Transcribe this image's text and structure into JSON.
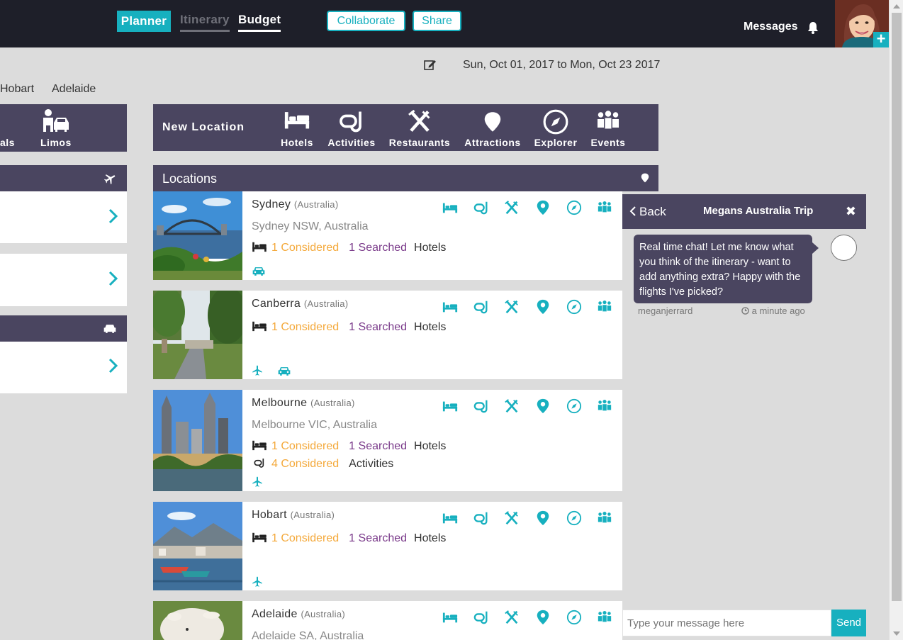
{
  "nav": {
    "tabs": [
      "Planner",
      "Itinerary",
      "Budget"
    ],
    "collaborate": "Collaborate",
    "share": "Share",
    "messages": "Messages",
    "avatar_plus": "+"
  },
  "trip": {
    "date_range": "Sun, Oct 01, 2017 to Mon, Oct 23 2017"
  },
  "left": {
    "city_tabs": [
      "Hobart",
      "Adelaide"
    ],
    "categories": [
      "als",
      "Limos"
    ]
  },
  "new_location": {
    "title": "New Location",
    "categories": [
      "Hotels",
      "Activities",
      "Restaurants",
      "Attractions",
      "Explorer",
      "Events"
    ]
  },
  "locations": {
    "title": "Locations",
    "items": [
      {
        "city": "Sydney",
        "country": "(Australia)",
        "address": "Sydney NSW, Australia",
        "stats": [
          {
            "considered": "1 Considered",
            "searched": "1 Searched",
            "type": "Hotels"
          }
        ]
      },
      {
        "city": "Canberra",
        "country": "(Australia)",
        "address": "",
        "stats": [
          {
            "considered": "1 Considered",
            "searched": "1 Searched",
            "type": "Hotels"
          }
        ]
      },
      {
        "city": "Melbourne",
        "country": "(Australia)",
        "address": "Melbourne VIC, Australia",
        "stats": [
          {
            "considered": "1 Considered",
            "searched": "1 Searched",
            "type": "Hotels"
          },
          {
            "considered": "4 Considered",
            "searched": "",
            "type": "Activities"
          }
        ]
      },
      {
        "city": "Hobart",
        "country": "(Australia)",
        "address": "",
        "stats": [
          {
            "considered": "1 Considered",
            "searched": "1 Searched",
            "type": "Hotels"
          }
        ]
      },
      {
        "city": "Adelaide",
        "country": "(Australia)",
        "address": "Adelaide SA, Australia",
        "stats": []
      }
    ]
  },
  "chat": {
    "back": "Back",
    "title": "Megans Australia Trip",
    "close": "✖",
    "message": "Real time chat! Let me know what you think of the itinerary - want to add anything extra? Happy with the flights I've picked?",
    "user": "meganjerrard",
    "time": "a minute ago",
    "input_placeholder": "Type your message here",
    "send": "Send"
  },
  "colors": {
    "accent": "#17b0bf",
    "panel": "#4a4560",
    "topbar": "#1e1f29",
    "considered": "#f4a93b",
    "searched": "#7a3a8a"
  }
}
